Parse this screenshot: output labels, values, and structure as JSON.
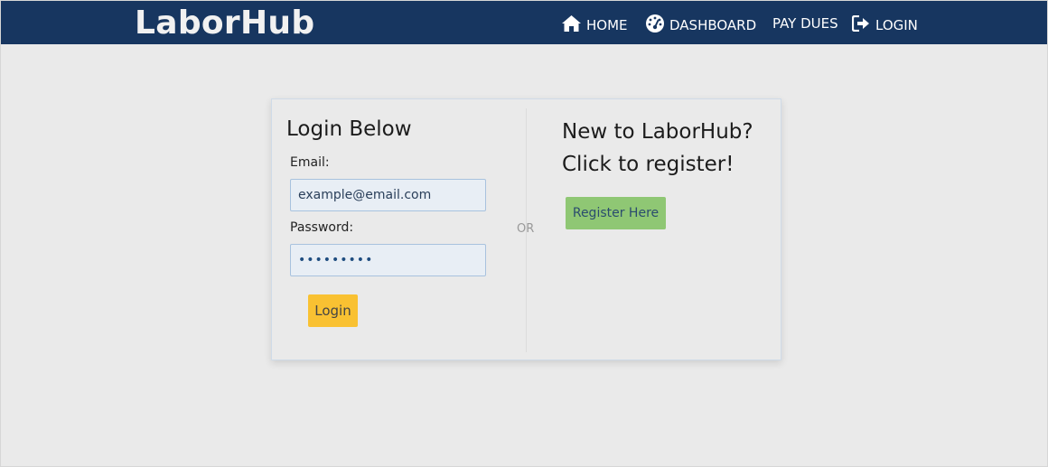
{
  "navbar": {
    "brand": "LaborHub",
    "items": [
      {
        "label": "HOME",
        "icon": "home-icon"
      },
      {
        "label": "DASHBOARD",
        "icon": "dashboard-icon"
      },
      {
        "label": "PAY DUES",
        "icon": ""
      },
      {
        "label": "LOGIN",
        "icon": "sign-in-icon"
      }
    ]
  },
  "login": {
    "title": "Login Below",
    "email_label": "Email:",
    "email_placeholder": "example@email.com",
    "password_label": "Password:",
    "password_value": "•••••••••",
    "button_label": "Login"
  },
  "separator": "OR",
  "register": {
    "title_line1": "New to LaborHub?",
    "title_line2": "Click to register!",
    "button_label": "Register Here"
  },
  "colors": {
    "navbar": "#173660",
    "background": "#eaeaea",
    "login_button": "#f9c132",
    "register_button": "#8fc774"
  }
}
